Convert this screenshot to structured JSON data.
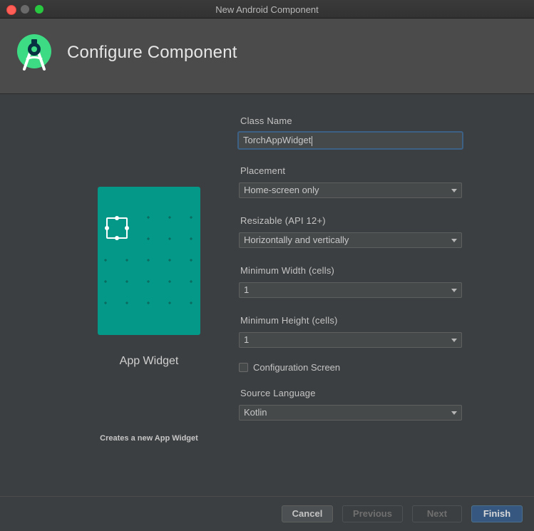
{
  "window": {
    "title": "New Android Component"
  },
  "header": {
    "title": "Configure Component"
  },
  "preview": {
    "name": "App Widget",
    "description": "Creates a new App Widget"
  },
  "form": {
    "class_name": {
      "label": "Class Name",
      "value": "TorchAppWidget"
    },
    "placement": {
      "label": "Placement",
      "value": "Home-screen only"
    },
    "resizable": {
      "label": "Resizable (API 12+)",
      "value": "Horizontally and vertically"
    },
    "min_width": {
      "label": "Minimum Width (cells)",
      "value": "1"
    },
    "min_height": {
      "label": "Minimum Height (cells)",
      "value": "1"
    },
    "config_screen": {
      "label": "Configuration Screen",
      "checked": false
    },
    "source_language": {
      "label": "Source Language",
      "value": "Kotlin"
    }
  },
  "footer": {
    "cancel": "Cancel",
    "previous": "Previous",
    "next": "Next",
    "finish": "Finish"
  },
  "colors": {
    "accent": "#365880",
    "preview_bg": "#049888",
    "logo_green": "#3ddc84"
  },
  "icons": [
    "android-studio-logo-icon",
    "dropdown-caret-icon",
    "widget-handle-icon"
  ]
}
